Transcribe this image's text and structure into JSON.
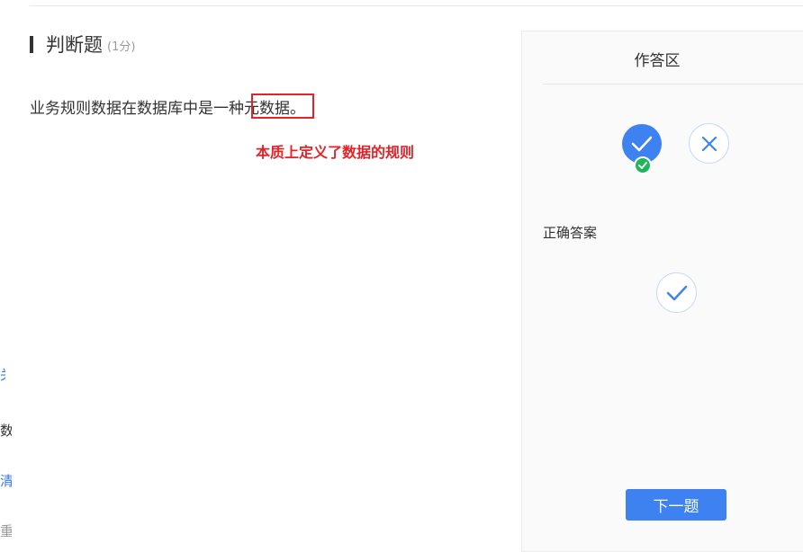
{
  "sidebar": {
    "items": [
      {
        "label": "关系"
      },
      {
        "label": "数据"
      },
      {
        "label": "清单"
      },
      {
        "label": "重复"
      }
    ]
  },
  "question": {
    "type_title": "判断题",
    "score": "(1分)",
    "text": "业务规则数据在数据库中是一种元数据。",
    "annotation": "本质上定义了数据的规则"
  },
  "answer_panel": {
    "title": "作答区",
    "options": [
      {
        "icon": "check-icon",
        "selected": true
      },
      {
        "icon": "close-icon",
        "selected": false
      }
    ],
    "correct_label": "正确答案",
    "correct_icon": "check-icon",
    "next_button": "下一题"
  },
  "colors": {
    "primary": "#3d82f0",
    "annotation_red": "#e0242a",
    "success_green": "#21b55b"
  }
}
